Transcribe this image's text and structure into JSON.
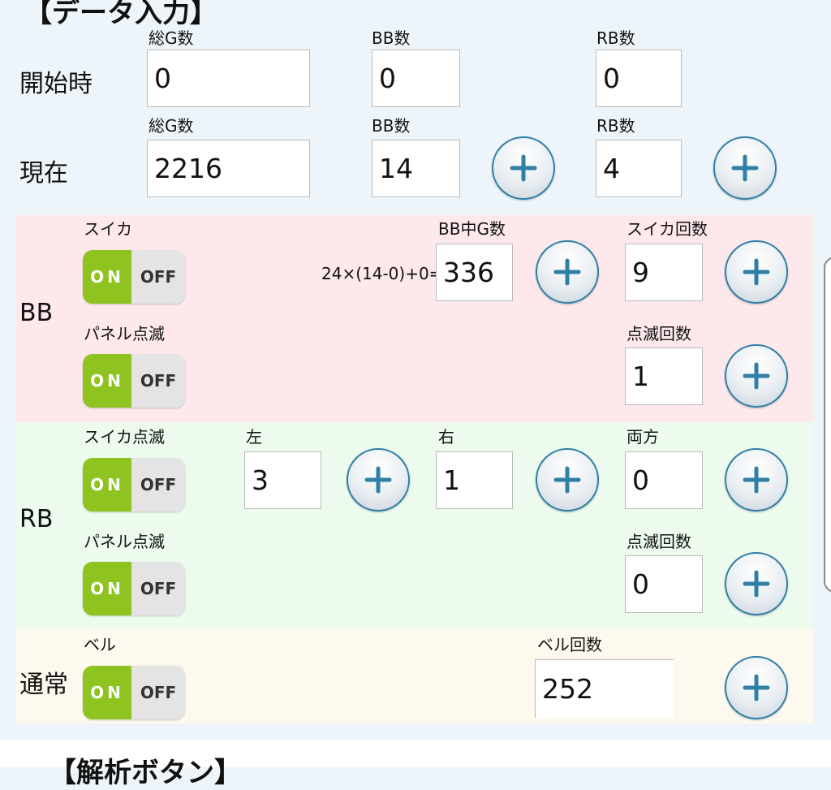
{
  "titles": {
    "data_input": "【データ入力】",
    "analysis": "【解析ボタン】"
  },
  "start": {
    "row_label": "開始時",
    "total_g_label": "総G数",
    "total_g_value": "0",
    "bb_label": "BB数",
    "bb_value": "0",
    "rb_label": "RB数",
    "rb_value": "0"
  },
  "current": {
    "row_label": "現在",
    "total_g_label": "総G数",
    "total_g_value": "2216",
    "bb_label": "BB数",
    "bb_value": "14",
    "rb_label": "RB数",
    "rb_value": "4"
  },
  "bb": {
    "row_label": "BB",
    "suika_label": "スイカ",
    "panel_label": "パネル点滅",
    "bb_g_label": "BB中G数",
    "formula": "24×(14-0)+0=",
    "bb_g_value": "336",
    "suika_count_label": "スイカ回数",
    "suika_count_value": "9",
    "blink_count_label": "点滅回数",
    "blink_count_value": "1"
  },
  "rb": {
    "row_label": "RB",
    "suika_blink_label": "スイカ点滅",
    "panel_label": "パネル点滅",
    "left_label": "左",
    "left_value": "3",
    "right_label": "右",
    "right_value": "1",
    "both_label": "両方",
    "both_value": "0",
    "blink_count_label": "点滅回数",
    "blink_count_value": "0"
  },
  "normal": {
    "row_label": "通常",
    "bell_label": "ベル",
    "bell_count_label": "ベル回数",
    "bell_count_value": "252"
  },
  "toggle": {
    "on": "ON",
    "off": "OFF"
  },
  "colors": {
    "bb_section": "#fde8ec",
    "rb_section": "#ecfbee",
    "normal_section": "#fdf9ee",
    "toggle_on": "#8fc31f",
    "plus_accent": "#2f7fa6"
  }
}
